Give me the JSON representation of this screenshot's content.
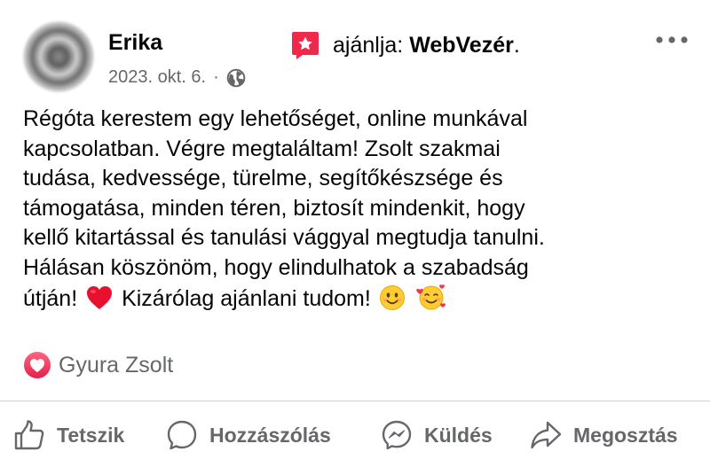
{
  "post": {
    "author": "Erika",
    "date": "2023. okt. 6.",
    "separator": "·",
    "recommendation": {
      "verb": "ajánlja:",
      "page": "WebVezér",
      "suffix": "."
    },
    "body": [
      "Régóta kerestem egy lehetőséget, online munkával",
      "kapcsolatban. Végre megtaláltam! Zsolt szakmai",
      "tudása, kedvessége, türelme, segítőkészsége és",
      "támogatása, minden téren, biztosít mindenkit, hogy",
      "kellő kitartással és tanulási vággyal megtudja tanulni.",
      "Hálásan köszönöm, hogy elindulhatok a szabadság"
    ],
    "last_line": {
      "part1": "útján!",
      "part2": "Kizárólag ajánlani tudom!"
    }
  },
  "reactions": {
    "name": "Gyura Zsolt"
  },
  "actions": {
    "like": "Tetszik",
    "comment": "Hozzászólás",
    "send": "Küldés",
    "share": "Megosztás"
  },
  "icons": {
    "more": "more-dots-icon",
    "privacy": "globe-icon",
    "recommend": "recommend-star-icon",
    "reaction": "love-reaction-icon",
    "heart_emoji": "red-heart-emoji",
    "smile_emoji": "smiling-face-emoji",
    "hearts_emoji": "smiling-face-with-hearts-emoji"
  },
  "colors": {
    "text": "#050505",
    "secondary": "#65676b",
    "recommend": "#f02849",
    "divider": "#ced0d4"
  }
}
